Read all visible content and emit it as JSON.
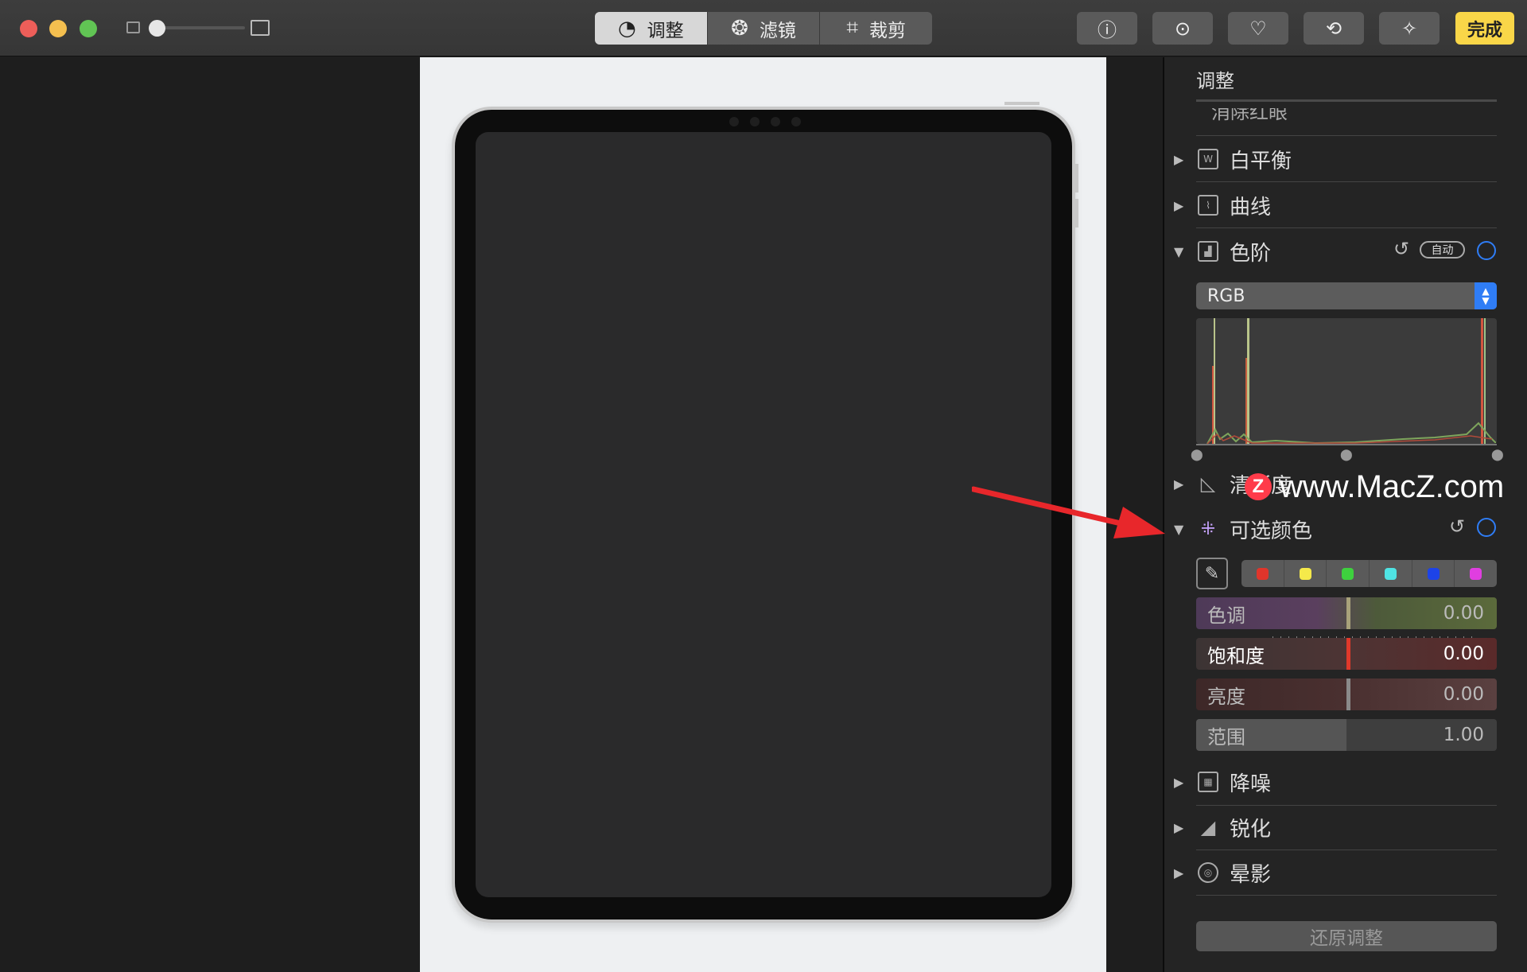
{
  "toolbar": {
    "tabs": [
      {
        "label": "调整",
        "icon": "adjust-dial-icon",
        "active": true
      },
      {
        "label": "滤镜",
        "icon": "filters-icon",
        "active": false
      },
      {
        "label": "裁剪",
        "icon": "crop-icon",
        "active": false
      }
    ],
    "buttons": [
      {
        "name": "info-button",
        "icon": "info-icon",
        "glyph": "ⓘ"
      },
      {
        "name": "more-button",
        "icon": "more-icon",
        "glyph": "⊙"
      },
      {
        "name": "favorite-button",
        "icon": "heart-icon",
        "glyph": "♡"
      },
      {
        "name": "rotate-button",
        "icon": "rotate-icon",
        "glyph": "⟲"
      },
      {
        "name": "enhance-button",
        "icon": "magic-wand-icon",
        "glyph": "✧"
      }
    ],
    "done_label": "完成",
    "done_color": "#f9d648"
  },
  "sidebar": {
    "title": "调整",
    "hidden_section": "消除红眼",
    "sections": {
      "white_balance": "白平衡",
      "curves": "曲线",
      "levels": "色阶",
      "definition": "清晰度",
      "selective_color": "可选颜色",
      "noise_reduction": "降噪",
      "sharpen": "锐化",
      "vignette": "晕影"
    },
    "levels": {
      "auto_label": "自动",
      "channel": "RGB"
    },
    "selective_color": {
      "swatches": [
        "#e0352b",
        "#f5e94a",
        "#3ed13e",
        "#4fe3e3",
        "#1d43e8",
        "#e03ee0"
      ],
      "sliders": [
        {
          "label": "色调",
          "value": "0.00"
        },
        {
          "label": "饱和度",
          "value": "0.00"
        },
        {
          "label": "亮度",
          "value": "0.00"
        },
        {
          "label": "范围",
          "value": "1.00"
        }
      ]
    },
    "reset_label": "还原调整",
    "accent_color": "#2f7df6"
  },
  "watermark": {
    "logo_letter": "Z",
    "text": "www.MacZ.com"
  }
}
